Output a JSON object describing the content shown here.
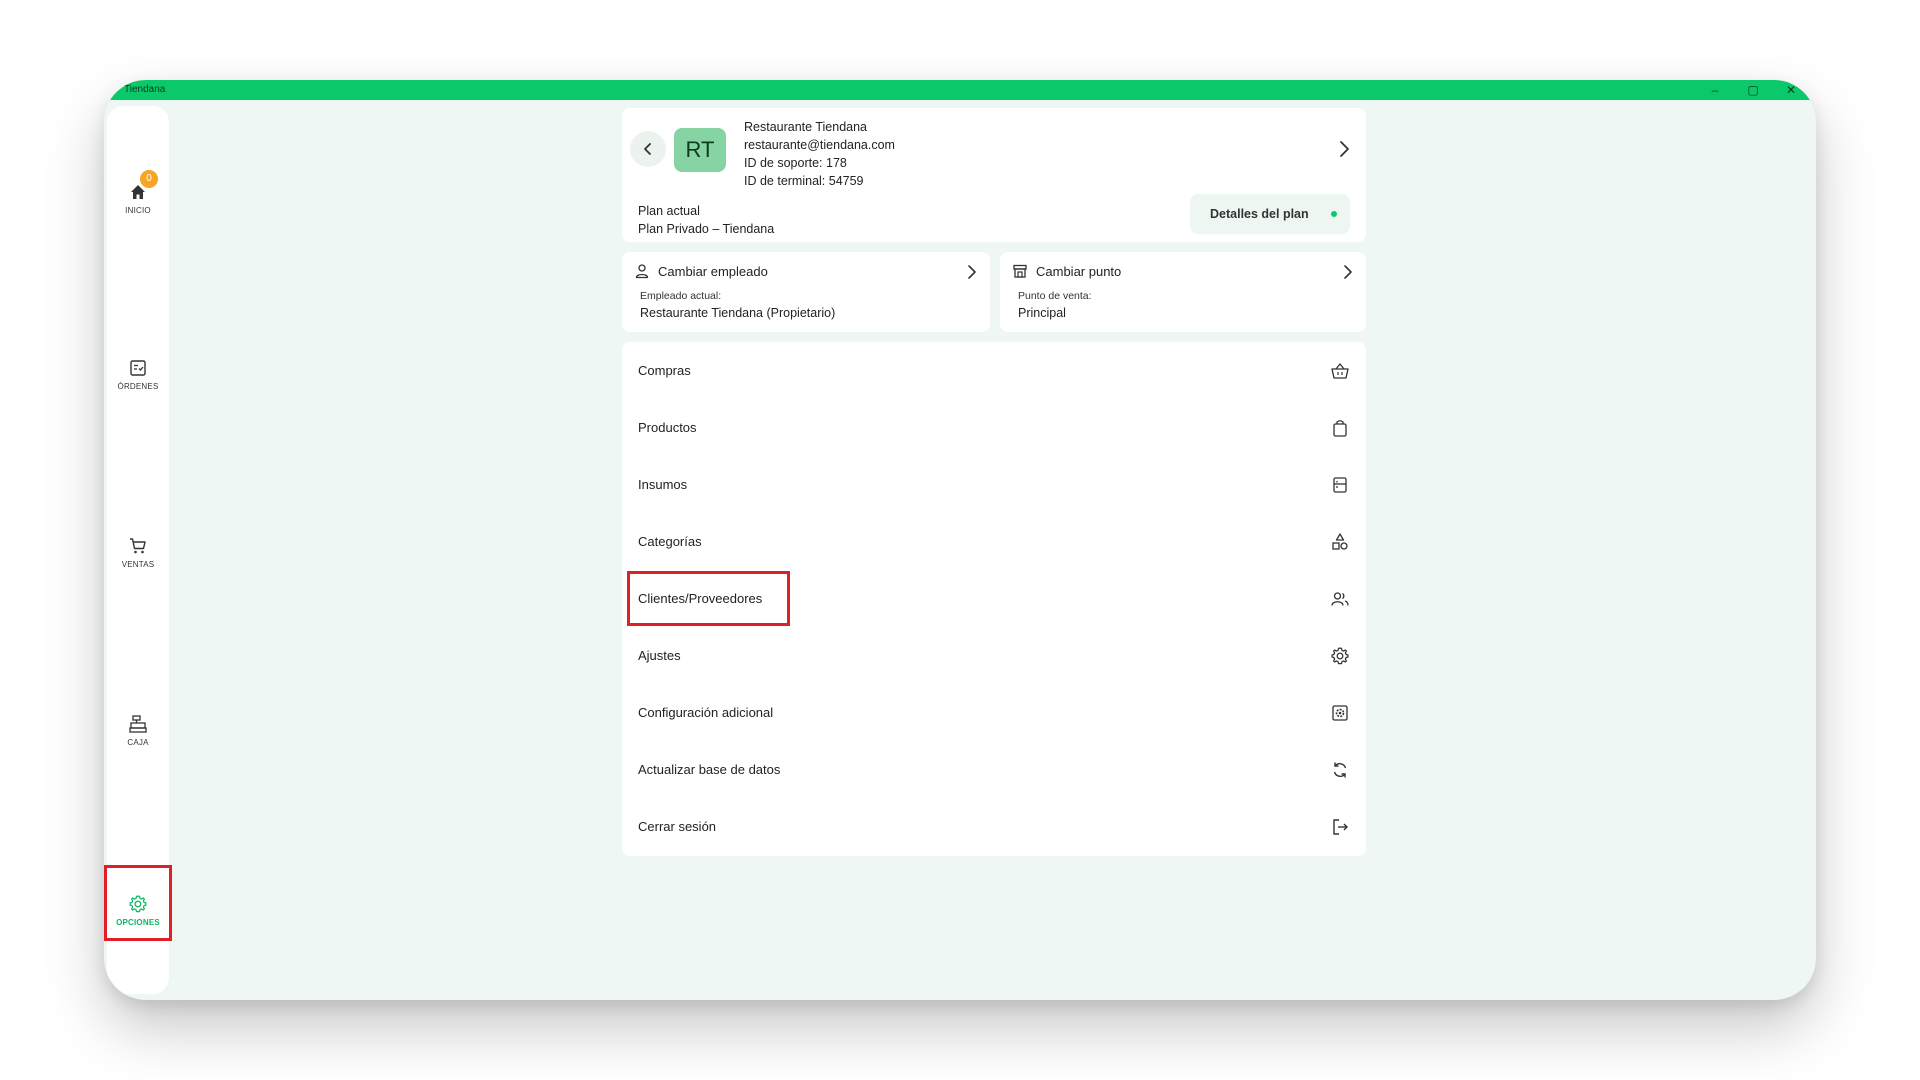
{
  "window": {
    "title": "Tiendana",
    "minimize": "–",
    "maximize": "▢",
    "close": "✕"
  },
  "sidebar": {
    "items": [
      {
        "label": "INICIO",
        "icon": "home-icon",
        "badge": "0"
      },
      {
        "label": "ÓRDENES",
        "icon": "orders-icon"
      },
      {
        "label": "VENTAS",
        "icon": "cart-icon"
      },
      {
        "label": "CAJA",
        "icon": "cash-register-icon"
      },
      {
        "label": "OPCIONES",
        "icon": "gear-icon",
        "active": true
      }
    ]
  },
  "profile": {
    "initials": "RT",
    "name": "Restaurante Tiendana",
    "email": "restaurante@tiendana.com",
    "support_id": "ID de soporte: 178",
    "terminal_id": "ID de terminal: 54759",
    "plan_label": "Plan actual",
    "plan_value": "Plan Privado  – Tiendana",
    "plan_details_button": "Detalles del plan"
  },
  "employee": {
    "title": "Cambiar empleado",
    "caption": "Empleado actual:",
    "value": "Restaurante Tiendana (Propietario)"
  },
  "point_of_sale": {
    "title": "Cambiar punto",
    "caption": "Punto de venta:",
    "value": "Principal"
  },
  "menu": {
    "items": [
      {
        "label": "Compras",
        "icon": "basket-icon"
      },
      {
        "label": "Productos",
        "icon": "bag-icon"
      },
      {
        "label": "Insumos",
        "icon": "supplies-icon"
      },
      {
        "label": "Categorías",
        "icon": "categories-icon"
      },
      {
        "label": "Clientes/Proveedores",
        "icon": "people-icon"
      },
      {
        "label": "Ajustes",
        "icon": "settings-icon"
      },
      {
        "label": "Configuración adicional",
        "icon": "additional-config-icon"
      },
      {
        "label": "Actualizar base de datos",
        "icon": "sync-icon"
      },
      {
        "label": "Cerrar sesión",
        "icon": "logout-icon"
      }
    ]
  },
  "colors": {
    "accent": "#0bc96a",
    "highlight": "#e01f26",
    "avatar_bg": "#86d3a3",
    "badge": "#f5a623"
  }
}
